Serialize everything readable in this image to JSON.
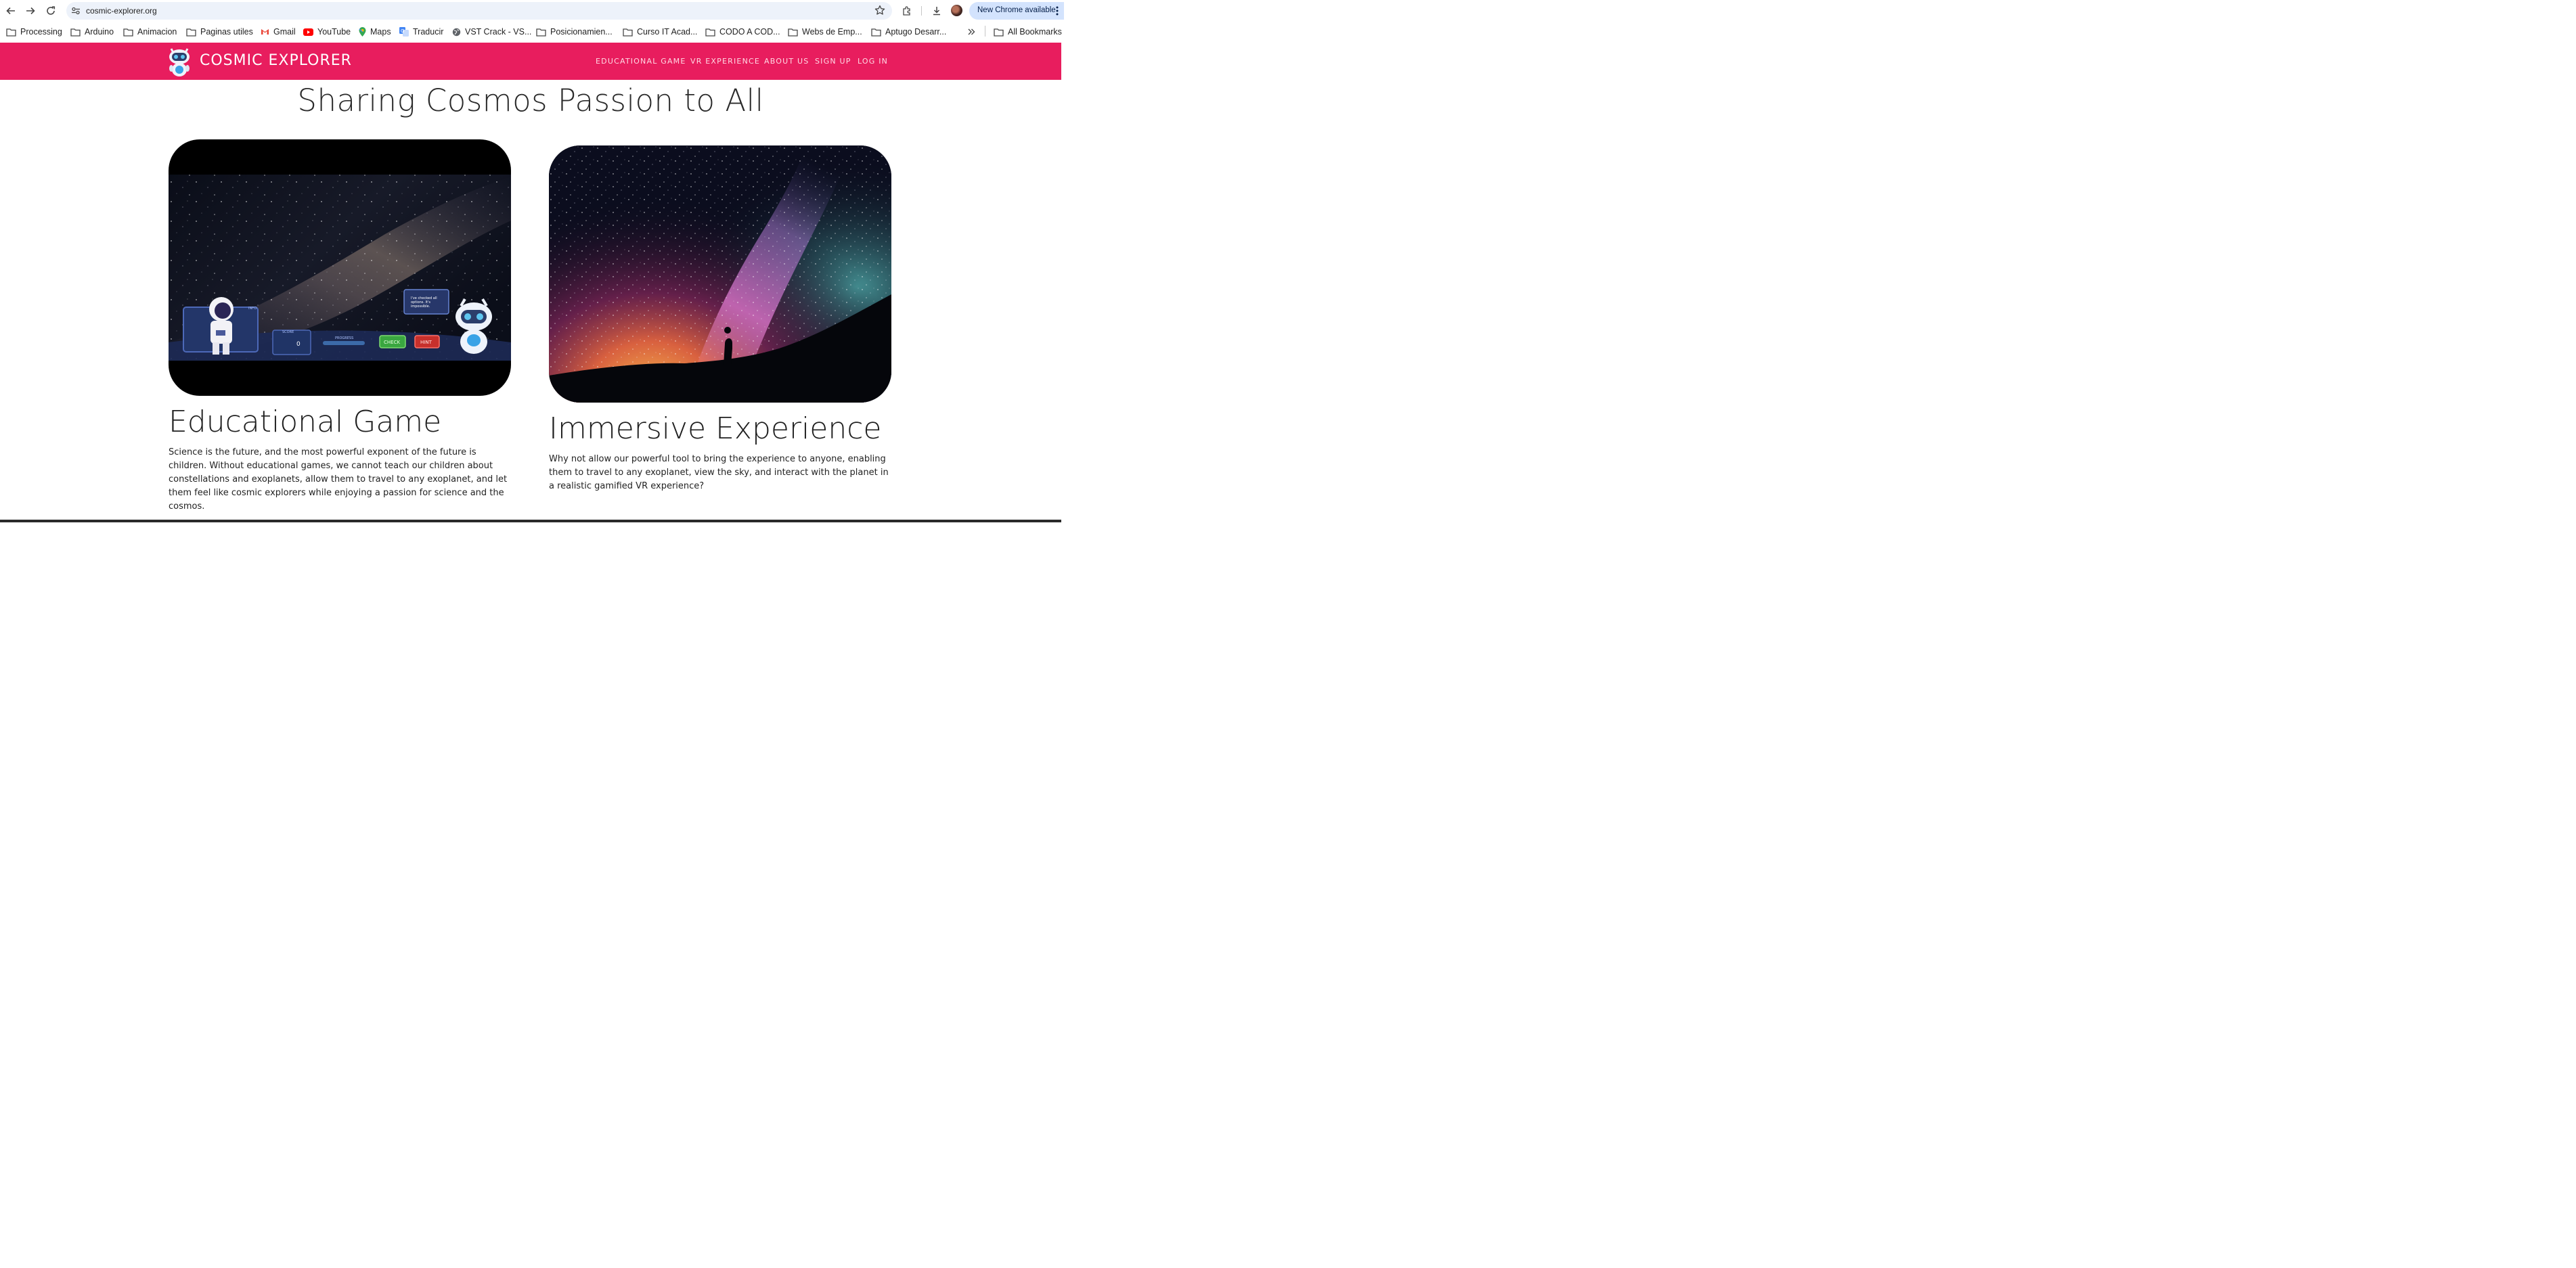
{
  "browser": {
    "url": "cosmic-explorer.org",
    "new_chrome_label": "New Chrome available",
    "bookmarks": [
      {
        "label": "Processing",
        "icon": "folder-icon"
      },
      {
        "label": "Arduino",
        "icon": "folder-icon"
      },
      {
        "label": "Animacion",
        "icon": "folder-icon"
      },
      {
        "label": "Paginas utiles",
        "icon": "folder-icon"
      },
      {
        "label": "Gmail",
        "icon": "gmail-icon"
      },
      {
        "label": "YouTube",
        "icon": "youtube-icon"
      },
      {
        "label": "Maps",
        "icon": "maps-icon"
      },
      {
        "label": "Traducir",
        "icon": "translate-icon"
      },
      {
        "label": "VST Crack - VS...",
        "icon": "globe-icon"
      },
      {
        "label": "Posicionamien...",
        "icon": "folder-icon"
      },
      {
        "label": "Curso IT Acad...",
        "icon": "folder-icon"
      },
      {
        "label": "CODO A COD...",
        "icon": "folder-icon"
      },
      {
        "label": "Webs de Emp...",
        "icon": "folder-icon"
      },
      {
        "label": "Aptugo Desarr...",
        "icon": "folder-icon"
      }
    ],
    "all_bookmarks_label": "All Bookmarks"
  },
  "site": {
    "brand": "COSMIC EXPLORER",
    "brand_color": "#e81d5e",
    "menu": [
      "EDUCATIONAL GAME",
      "VR EXPERIENCE",
      "ABOUT US",
      "SIGN UP",
      "LOG IN"
    ],
    "hero_title": "Sharing Cosmos Passion to All"
  },
  "game_screenshot": {
    "info_label": "INFO",
    "score_label": "SCORE",
    "score_value": "0",
    "progress_label": "PROGRESS",
    "check_label": "CHECK",
    "hint_label": "HINT",
    "speech": [
      "I've checked all",
      "options. It's",
      "impossible."
    ]
  },
  "cards": [
    {
      "title": "Educational Game",
      "text": "Science is the future, and the most powerful exponent of the future is children. Without educational games, we cannot teach our children about constellations and exoplanets, allow them to travel to any exoplanet, and let them feel like cosmic explorers while enjoying a passion for science and the cosmos."
    },
    {
      "title": "Immersive Experience",
      "text": "Why not allow our powerful tool to bring the experience to anyone, enabling them to travel to any exoplanet, view the sky, and interact with the planet in a realistic gamified VR experience?"
    }
  ]
}
